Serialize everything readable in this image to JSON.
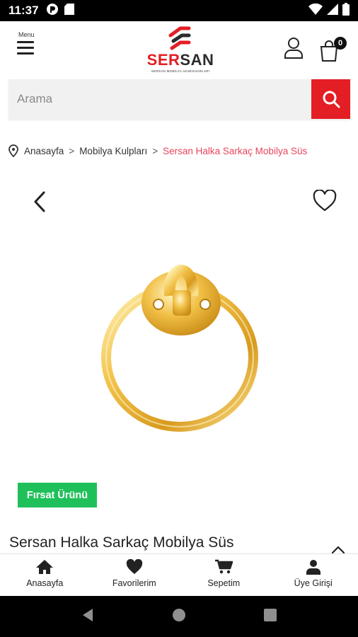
{
  "status_bar": {
    "time": "11:37",
    "left_icons": [
      "data-saver-icon",
      "sd-card-icon"
    ],
    "right_icons": [
      "wifi-icon",
      "signal-icon",
      "battery-icon"
    ]
  },
  "header": {
    "menu_label": "Menu",
    "logo": {
      "brand_part1": "SER",
      "brand_part2": "SAN",
      "tagline": "SERSAN MOBİLYA AKSESUARLARI"
    },
    "cart_count": "0"
  },
  "search": {
    "placeholder": "Arama",
    "value": ""
  },
  "breadcrumb": {
    "items": [
      "Anasayfa",
      "Mobilya Kulpları",
      "Sersan Halka Sarkaç Mobilya Süs"
    ],
    "separator": ">"
  },
  "product": {
    "badge": "Fırsat Ürünü",
    "title": "Sersan Halka Sarkaç Mobilya Süs"
  },
  "bottom_nav": {
    "items": [
      {
        "label": "Anasayfa",
        "icon": "home-icon"
      },
      {
        "label": "Favorilerim",
        "icon": "heart-icon"
      },
      {
        "label": "Sepetim",
        "icon": "cart-icon"
      },
      {
        "label": "Üye Girişi",
        "icon": "user-icon"
      }
    ]
  },
  "colors": {
    "brand_red": "#e31e24",
    "breadcrumb_active": "#e8455d",
    "badge_green": "#1fc05a",
    "gold": "#e8b53a"
  }
}
